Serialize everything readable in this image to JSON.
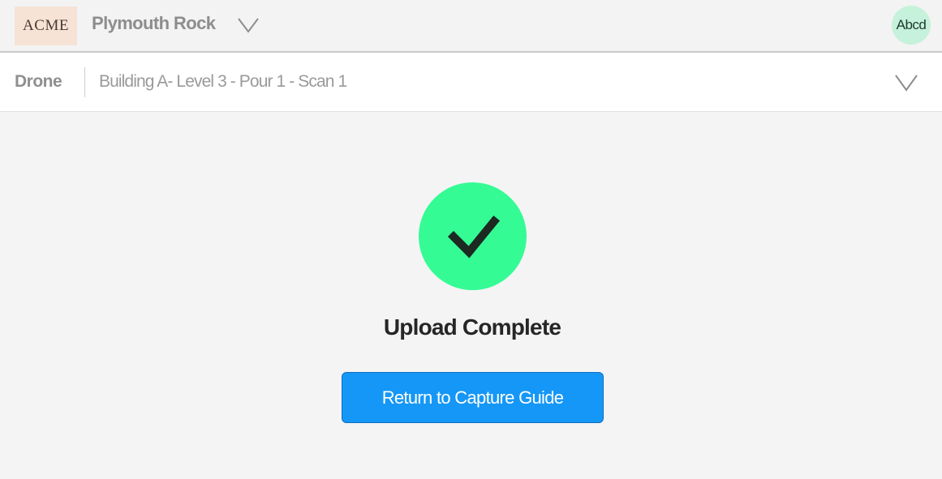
{
  "header": {
    "logo_text": "ACME",
    "project_name": "Plymouth Rock",
    "project_dropdown_icon": "chevron-down-icon",
    "avatar_text": "Abcd"
  },
  "subheader": {
    "mode": "Drone",
    "scan_name": "Building A- Level 3 - Pour 1 - Scan 1",
    "scan_dropdown_icon": "chevron-down-icon"
  },
  "main": {
    "status_icon": "checkmark-icon",
    "status_title": "Upload Complete",
    "return_button_label": "Return to Capture Guide"
  },
  "colors": {
    "success": "#35fb95",
    "primary_button": "#1597f7",
    "logo_bg": "#f6e3d6",
    "avatar_bg": "#c6f1da"
  }
}
